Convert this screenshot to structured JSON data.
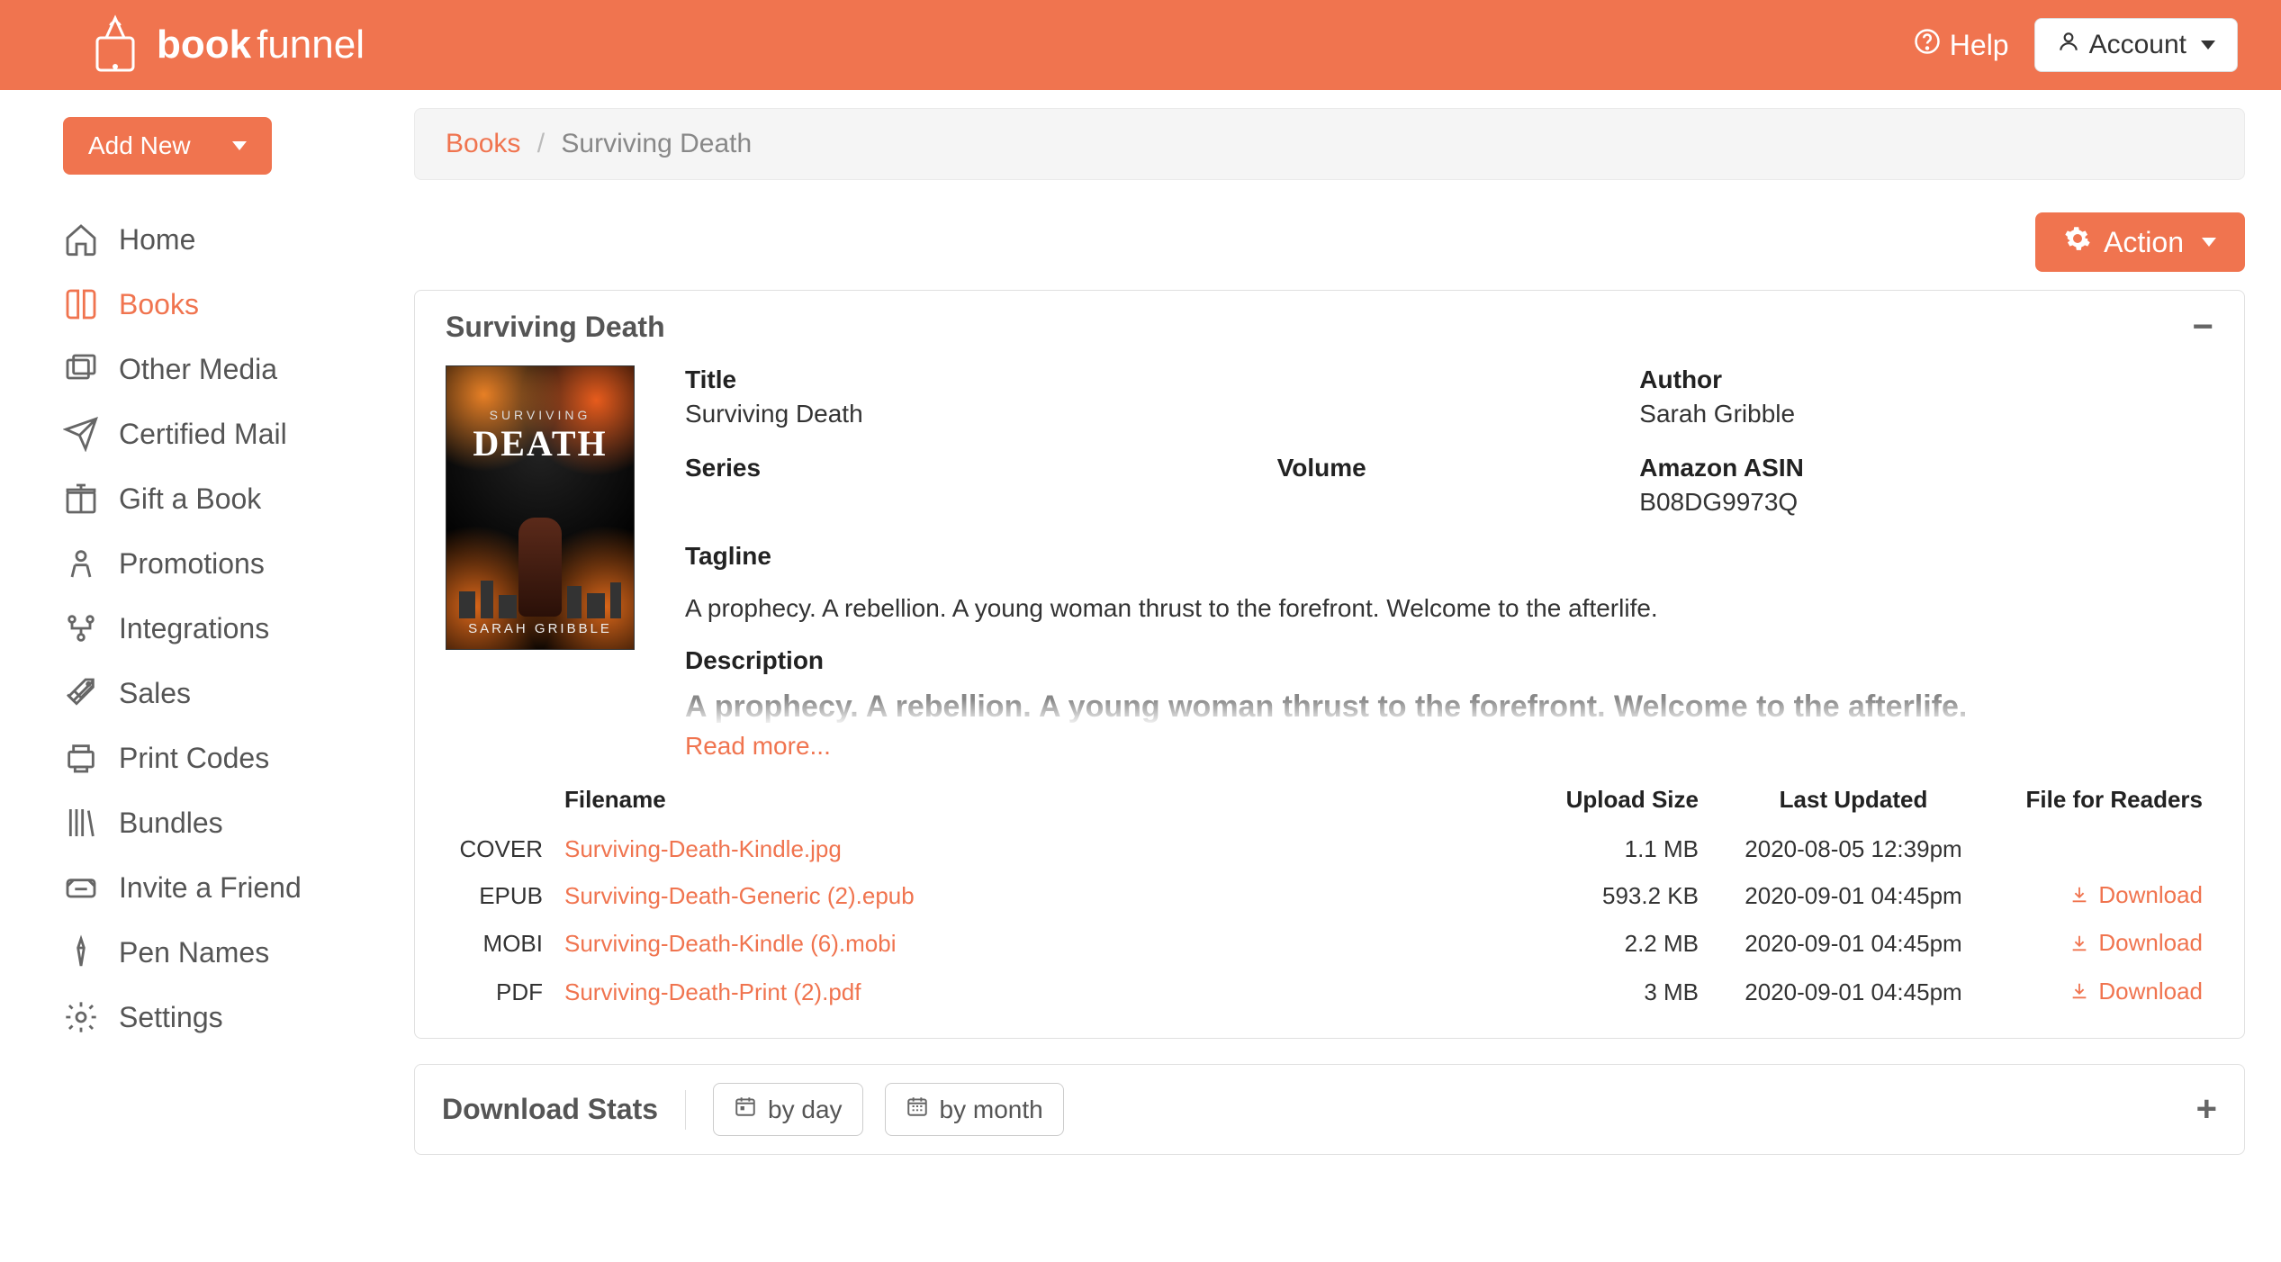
{
  "brand": {
    "name1": "book",
    "name2": "funnel"
  },
  "topbar": {
    "help_label": "Help",
    "account_label": "Account"
  },
  "sidebar": {
    "add_new_label": "Add New",
    "items": [
      {
        "label": "Home"
      },
      {
        "label": "Books"
      },
      {
        "label": "Other Media"
      },
      {
        "label": "Certified Mail"
      },
      {
        "label": "Gift a Book"
      },
      {
        "label": "Promotions"
      },
      {
        "label": "Integrations"
      },
      {
        "label": "Sales"
      },
      {
        "label": "Print Codes"
      },
      {
        "label": "Bundles"
      },
      {
        "label": "Invite a Friend"
      },
      {
        "label": "Pen Names"
      },
      {
        "label": "Settings"
      }
    ],
    "active_index": 1
  },
  "breadcrumb": {
    "root": "Books",
    "current": "Surviving Death"
  },
  "action_button_label": "Action",
  "book": {
    "panel_title": "Surviving Death",
    "labels": {
      "title": "Title",
      "author": "Author",
      "series": "Series",
      "volume": "Volume",
      "asin": "Amazon ASIN",
      "tagline": "Tagline",
      "description": "Description"
    },
    "title": "Surviving Death",
    "author": "Sarah Gribble",
    "series": "",
    "volume": "",
    "asin": "B08DG9973Q",
    "tagline": "A prophecy. A rebellion. A young woman thrust to the forefront. Welcome to the afterlife.",
    "description_preview": "A prophecy. A rebellion. A young woman thrust to the forefront. Welcome to the afterlife.",
    "read_more_label": "Read more...",
    "cover_text": {
      "small": "SURVIVING",
      "big": "DEATH",
      "author": "SARAH GRIBBLE"
    }
  },
  "files": {
    "headers": {
      "filename": "Filename",
      "upload_size": "Upload Size",
      "last_updated": "Last Updated",
      "file_for_readers": "File for Readers"
    },
    "download_label": "Download",
    "rows": [
      {
        "type": "COVER",
        "filename": "Surviving-Death-Kindle.jpg",
        "size": "1.1 MB",
        "updated": "2020-08-05 12:39pm",
        "downloadable": false
      },
      {
        "type": "EPUB",
        "filename": "Surviving-Death-Generic (2).epub",
        "size": "593.2 KB",
        "updated": "2020-09-01 04:45pm",
        "downloadable": true
      },
      {
        "type": "MOBI",
        "filename": "Surviving-Death-Kindle (6).mobi",
        "size": "2.2 MB",
        "updated": "2020-09-01 04:45pm",
        "downloadable": true
      },
      {
        "type": "PDF",
        "filename": "Surviving-Death-Print (2).pdf",
        "size": "3 MB",
        "updated": "2020-09-01 04:45pm",
        "downloadable": true
      }
    ]
  },
  "stats": {
    "title": "Download Stats",
    "by_day_label": "by day",
    "by_month_label": "by month"
  }
}
